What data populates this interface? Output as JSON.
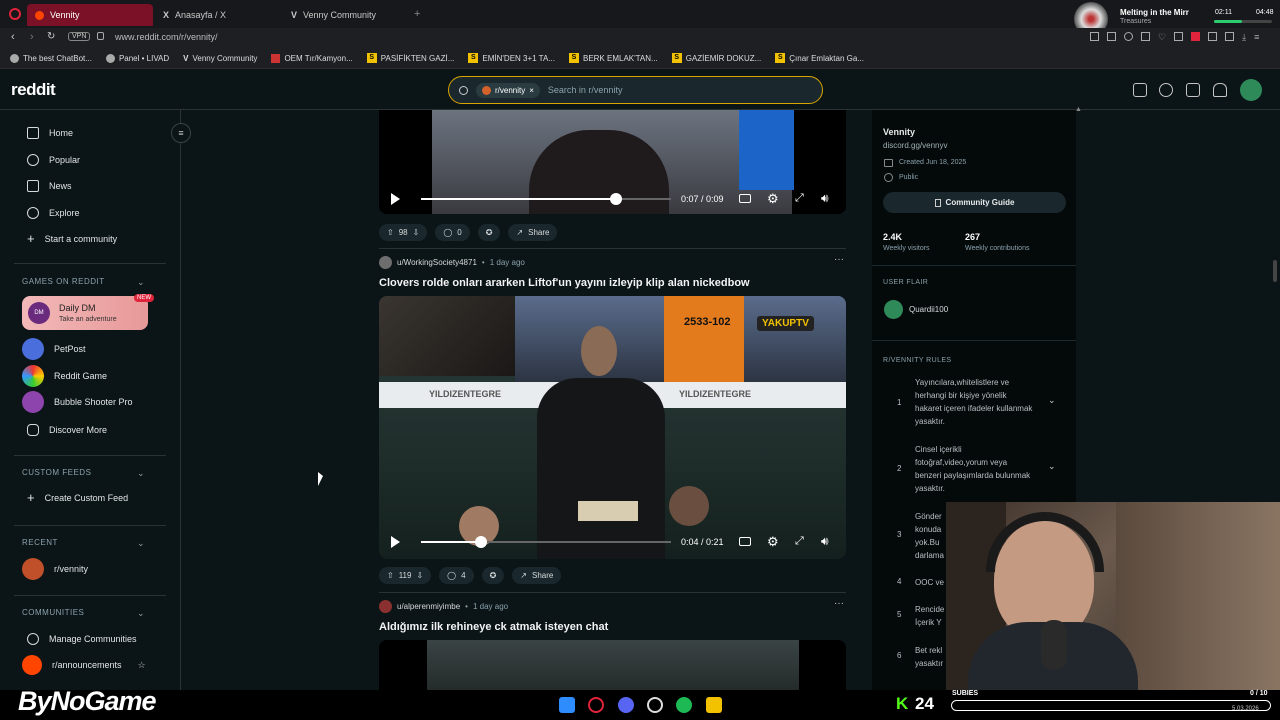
{
  "browser": {
    "tabs": [
      {
        "label": "Vennity",
        "active": true
      },
      {
        "label": "Anasayfa / X",
        "active": false
      },
      {
        "label": "Venny Community",
        "active": false
      }
    ],
    "vpn_label": "VPN",
    "url": "www.reddit.com/r/vennity/",
    "bookmarks": [
      "The best ChatBot...",
      "Panel • LIVAD",
      "Venny Community",
      "OEM Tır/Kamyon...",
      "PASİFİKTEN GAZİ...",
      "EMİN'DEN 3+1 TA...",
      "BERK EMLAK'TAN...",
      "GAZİEMİR DOKUZ...",
      "Çınar Emlaktan Ga..."
    ],
    "media": {
      "title": "Melting in the Mirr",
      "subtitle": "Treasures"
    },
    "clock": {
      "left": "02:11",
      "right": "04:48"
    }
  },
  "reddit": {
    "logo": "reddit",
    "search": {
      "chip": "r/vennity",
      "placeholder": "Search in r/vennity"
    }
  },
  "leftnav": {
    "items": [
      "Home",
      "Popular",
      "News",
      "Explore",
      "Start a community"
    ],
    "games_header": "GAMES ON REDDIT",
    "games": [
      {
        "name": "Daily DM",
        "sub": "Take an adventure",
        "badge": "NEW"
      },
      {
        "name": "PetPost"
      },
      {
        "name": "Reddit Game"
      },
      {
        "name": "Bubble Shooter Pro"
      },
      {
        "name": "Discover More"
      }
    ],
    "custom_header": "CUSTOM FEEDS",
    "create_feed": "Create Custom Feed",
    "recent_header": "RECENT",
    "recent": [
      "r/vennity"
    ],
    "communities_header": "COMMUNITIES",
    "communities": [
      "Manage Communities",
      "r/announcements"
    ]
  },
  "feed": {
    "post1": {
      "time": "0:07 / 0:09",
      "progress": 0.78,
      "votes": "98",
      "comments": "0",
      "share": "Share"
    },
    "post2": {
      "author": "u/WorkingSociety4871",
      "age": "1 day ago",
      "title": "Clovers rolde onları ararken Liftof'un yayını izleyip klip alan nickedbow",
      "time": "0:04 / 0:21",
      "progress": 0.24,
      "votes": "119",
      "comments": "4",
      "share": "Share",
      "overlay": {
        "plate": "2533-102",
        "ad": "YILDIZENTEGRE",
        "brand": "YAKUPTV"
      }
    },
    "post3": {
      "author": "u/alperenmiyimbe",
      "age": "1 day ago",
      "title": "Aldığımız ilk rehineye ck atmak isteyen chat"
    }
  },
  "sidebar": {
    "name": "Vennity",
    "link": "discord.gg/vennyv",
    "created": "Created Jun 18, 2025",
    "visibility": "Public",
    "guide": "Community Guide",
    "visitors": "2.4K",
    "visitors_label": "Weekly visitors",
    "contribs": "267",
    "contribs_label": "Weekly contributions",
    "flair_header": "USER FLAIR",
    "flair_user": "Quardii100",
    "rules_header": "R/VENNITY RULES",
    "rules": [
      {
        "n": "1",
        "text": "Yayıncılara,whitelistlere ve herhangi bir kişiye yönelik hakaret içeren ifadeler kullanmak yasaktır."
      },
      {
        "n": "2",
        "text": "Cinsel içerikli fotoğraf,video,yorum veya benzeri paylaşımlarda bulunmak yasaktır."
      },
      {
        "n": "3",
        "text": "Gönder konuda yok.Bu darlama"
      },
      {
        "n": "4",
        "text": "OOC ve"
      },
      {
        "n": "5",
        "text": "Rencide İçerik Y"
      },
      {
        "n": "6",
        "text": "Bet rekl yasaktır"
      }
    ]
  },
  "overlay": {
    "brand": "ByNoGame",
    "subs_label": "SUBIES",
    "counter": "0 / 10",
    "date": "5.03.2026"
  }
}
